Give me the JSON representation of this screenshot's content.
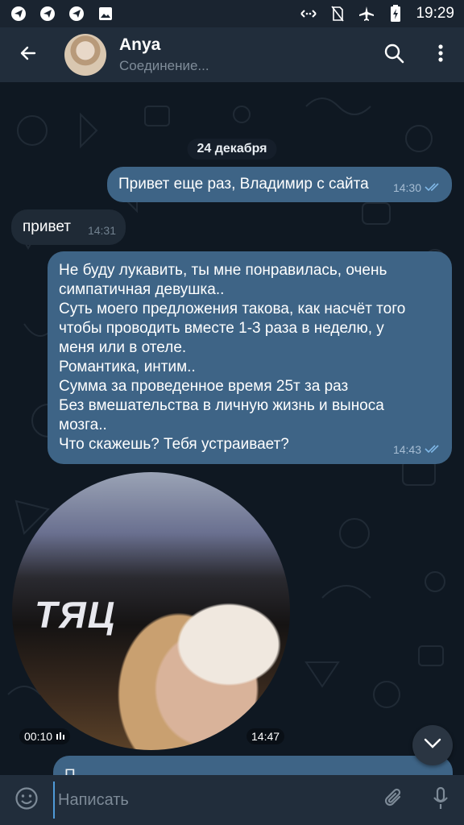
{
  "status_bar": {
    "time": "19:29",
    "left_icons": [
      "telegram-icon",
      "telegram-icon",
      "telegram-icon",
      "image-icon"
    ],
    "right_icons": [
      "data-saver-icon",
      "no-sim-icon",
      "airplane-icon",
      "battery-icon"
    ]
  },
  "header": {
    "title": "Anya",
    "status": "Соединение..."
  },
  "chat": {
    "date_chip": "24 декабря",
    "messages": [
      {
        "text": "Привет еще раз, Владимир с сайта",
        "time": "14:30",
        "outgoing": true
      },
      {
        "text": "привет",
        "time": "14:31",
        "outgoing": false
      },
      {
        "lines": [
          "Не буду лукавить, ты мне понравилась, очень",
          "симпатичная девушка..",
          "Суть моего предложения такова, как насчёт того",
          "чтобы проводить вместе 1-3 раза в неделю, у",
          "меня или в отеле.",
          "Романтика, интим..",
          "Сумма за проведенное время 25т за раз",
          "Без вмешательства в личную жизнь и выноса",
          "мозга..",
          "Что скажешь? Тебя устраивает?"
        ],
        "time": "14:43",
        "outgoing": true
      }
    ],
    "video_note": {
      "duration": "00:10",
      "time": "14:47",
      "sign_text": "ТЯЦ"
    },
    "partial_message": "П..."
  },
  "composer": {
    "placeholder": "Написать"
  },
  "colors": {
    "outgoing_bubble": "#3e6486",
    "incoming_bubble": "#1f2a36",
    "header": "#212d3b",
    "accent": "#4f9ad8"
  }
}
